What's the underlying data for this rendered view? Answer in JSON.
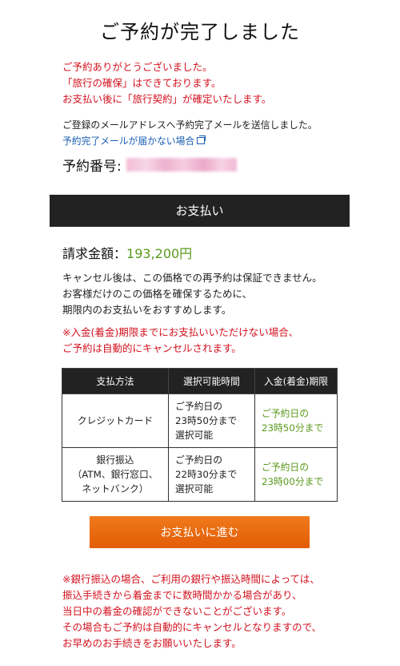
{
  "title": "ご予約が完了しました",
  "thanks": {
    "line1": "ご予約ありがとうございました。",
    "line2": "「旅行の確保」はできております。",
    "line3": "お支払い後に「旅行契約」が確定いたします。"
  },
  "mail": {
    "sent": "ご登録のメールアドレスへ予約完了メールを送信しました。",
    "link": "予約完了メールが届かない場合"
  },
  "reservation": {
    "label": "予約番号:"
  },
  "payment_header": "お支払い",
  "amount": {
    "label": "請求金額：",
    "value": "193,200円"
  },
  "notice": {
    "line1": "キャンセル後は、この価格での再予約は保証できません。",
    "line2": "お客様だけのこの価格を確保するために、",
    "line3": "期限内のお支払いをおすすめします。"
  },
  "warning": {
    "line1": "※入金(着金)期限までにお支払いいただけない場合、",
    "line2": "ご予約は自動的にキャンセルされます。"
  },
  "table": {
    "headers": [
      "支払方法",
      "選択可能時間",
      "入金(着金)期限"
    ],
    "rows": [
      {
        "method": [
          "クレジットカード"
        ],
        "time": [
          "ご予約日の",
          "23時50分まで",
          "選択可能"
        ],
        "limit": [
          "ご予約日の",
          "23時50分まで"
        ]
      },
      {
        "method": [
          "銀行振込",
          "（ATM、銀行窓口、",
          "ネットバンク）"
        ],
        "time": [
          "ご予約日の",
          "22時30分まで",
          "選択可能"
        ],
        "limit": [
          "ご予約日の",
          "23時00分まで"
        ]
      }
    ]
  },
  "button_label": "お支払いに進む",
  "bottom_note": {
    "line1": "※銀行振込の場合、ご利用の銀行や振込時間によっては、",
    "line2": "振込手続きから着金までに数時間かかる場合があり、",
    "line3": "当日中の着金の確認ができないことがございます。",
    "line4": "その場合もご予約は自動的にキャンセルとなりますので、",
    "line5": "お早めのお手続きをお願いいたします。"
  },
  "colors": {
    "accent_red": "#d3121f",
    "accent_green": "#5a9a1c",
    "button_orange": "#e25c06",
    "header_dark": "#222222"
  }
}
